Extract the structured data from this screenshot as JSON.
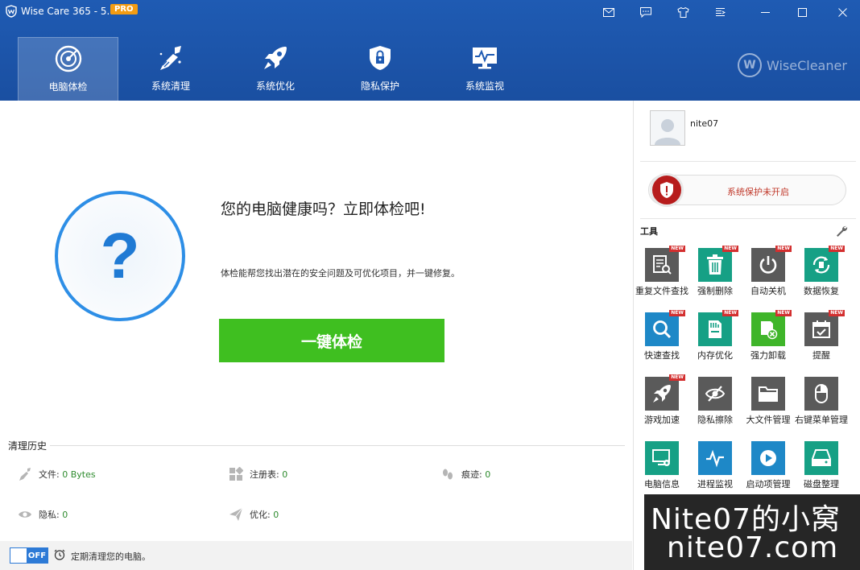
{
  "titlebar": {
    "title": "Wise Care 365 - 5.9.1",
    "badge": "PRO"
  },
  "nav": [
    {
      "label": "电脑体检",
      "icon": "radar-icon",
      "active": true
    },
    {
      "label": "系统清理",
      "icon": "broom-icon"
    },
    {
      "label": "系统优化",
      "icon": "rocket-icon"
    },
    {
      "label": "隐私保护",
      "icon": "shield-lock-icon"
    },
    {
      "label": "系统监视",
      "icon": "monitor-pulse-icon"
    }
  ],
  "brand": {
    "mark": "W",
    "name": "WiseCleaner"
  },
  "main": {
    "question": "?",
    "title": "您的电脑健康吗？立即体检吧!",
    "description": "体检能帮您找出潜在的安全问题及可优化项目，并一键修复。",
    "check_button": "一键体检"
  },
  "history": {
    "title": "清理历史",
    "items": {
      "files": {
        "label": "文件:",
        "value": "0 Bytes"
      },
      "registry": {
        "label": "注册表:",
        "value": "0"
      },
      "traces": {
        "label": "痕迹:",
        "value": "0"
      },
      "privacy": {
        "label": "隐私:",
        "value": "0"
      },
      "optimize": {
        "label": "优化:",
        "value": "0"
      }
    }
  },
  "bottom": {
    "toggle": "OFF",
    "schedule_text": "定期清理您的电脑。"
  },
  "sidebar": {
    "username": "nite07",
    "protection_status": "系统保护未开启",
    "tools_title": "工具",
    "new_badge": "NEW",
    "tools": [
      {
        "label": "重复文件查找",
        "color": "#5a5a5a",
        "new": true
      },
      {
        "label": "强制删除",
        "color": "#16a085",
        "new": true
      },
      {
        "label": "自动关机",
        "color": "#5a5a5a",
        "new": true
      },
      {
        "label": "数据恢复",
        "color": "#16a085",
        "new": true
      },
      {
        "label": "快速查找",
        "color": "#1e88c7",
        "new": true
      },
      {
        "label": "内存优化",
        "color": "#16a085",
        "new": true
      },
      {
        "label": "强力卸载",
        "color": "#3fb52a",
        "new": true
      },
      {
        "label": "提醒",
        "color": "#5a5a5a",
        "new": true
      },
      {
        "label": "游戏加速",
        "color": "#5a5a5a",
        "new": true
      },
      {
        "label": "隐私擦除",
        "color": "#5a5a5a",
        "new": false
      },
      {
        "label": "大文件管理",
        "color": "#5a5a5a",
        "new": false
      },
      {
        "label": "右键菜单管理",
        "color": "#5a5a5a",
        "new": false
      },
      {
        "label": "电脑信息",
        "color": "#16a085",
        "new": false
      },
      {
        "label": "进程监视",
        "color": "#1e88c7",
        "new": false
      },
      {
        "label": "启动项管理",
        "color": "#1e88c7",
        "new": false
      },
      {
        "label": "磁盘整理",
        "color": "#16a085",
        "new": false
      }
    ]
  },
  "watermark": {
    "line1": "Nite07的小窝",
    "line2": "nite07.com"
  }
}
